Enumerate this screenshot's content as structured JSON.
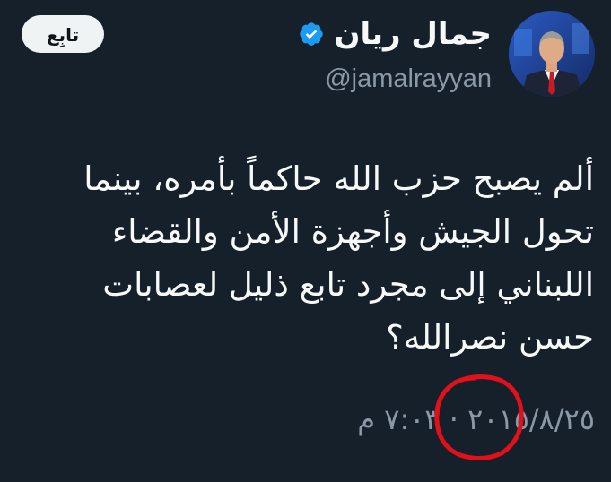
{
  "author": {
    "display_name": "جمال ريان",
    "handle": "@jamalrayyan",
    "verified_icon": "verified-badge-icon",
    "avatar_icon": "profile-photo"
  },
  "follow_button": {
    "label": "تابِع"
  },
  "tweet": {
    "text": "ألم يصبح حزب الله حاكماً بأمره، بينما\nتحول الجيش وأجهزة الأمن والقضاء\nاللبناني إلى مجرد تابع ذليل لعصابات\nحسن نصرالله؟",
    "time": "٧:٠٣ م",
    "separator": "·",
    "date": "٢٠١٥/٨/٢٥"
  },
  "colors": {
    "background": "#15202b",
    "text_primary": "#f7f9f9",
    "text_secondary": "#8b98a5",
    "verified_blue": "#1d9bf0",
    "follow_bg": "#eff3f4",
    "annotation_red": "#e3101a"
  }
}
